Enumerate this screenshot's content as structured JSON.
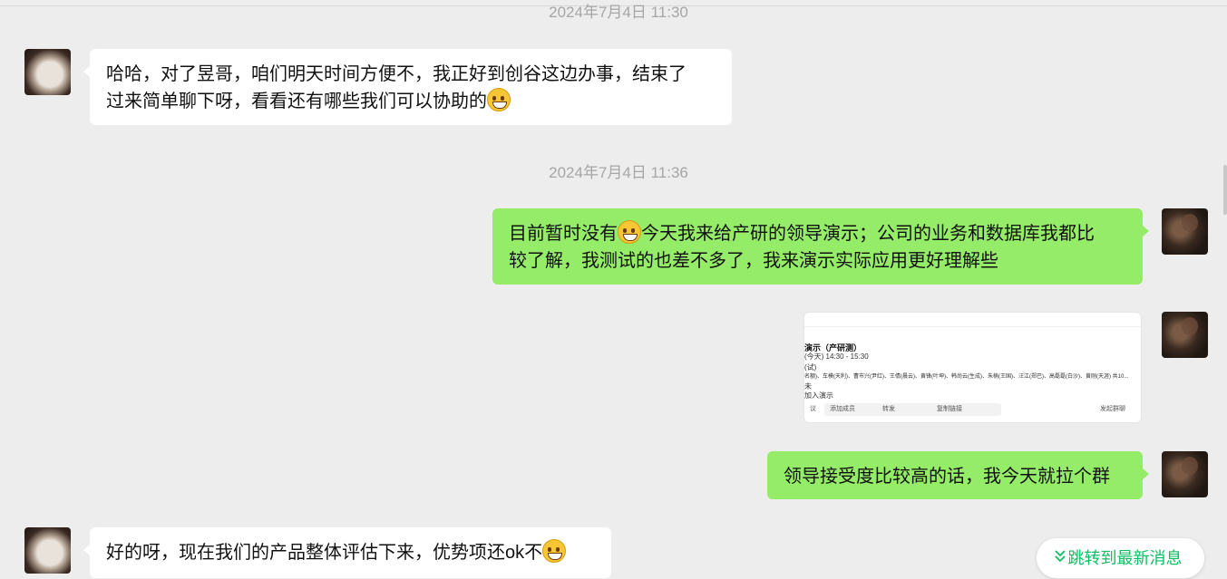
{
  "timestamps": [
    "2024年7月4日 11:30",
    "2024年7月4日 11:36"
  ],
  "messages": [
    {
      "side": "left",
      "text_line1": "哈哈，对了昱哥，咱们明天时间方便不，我正好到创谷这边办事，结束了",
      "text_line2": "过来简单聊下呀，看看还有哪些我们可以协助的",
      "emoji": "grin-emoji"
    },
    {
      "side": "right",
      "text_line1_a": "目前暂时没有",
      "emoji": "tears-of-joy-emoji",
      "text_line1_b": "今天我来给产研的领导演示；公司的业务和数据库我都比",
      "text_line2": "较了解，我测试的也差不多了，我来演示实际应用更好理解些"
    },
    {
      "side": "right",
      "type": "image"
    },
    {
      "side": "right",
      "text": "领导接受度比较高的话，我今天就拉个群"
    },
    {
      "side": "left",
      "text": "好的呀，现在我们的产品整体评估下来，优势项还ok不",
      "emoji": "flushed-emoji"
    }
  ],
  "screenshot_image": {
    "title": "演示（产研测）",
    "time": "(今天) 14:30 - 15:30",
    "line3": "(试)",
    "line4": "名额)、车模(天利)、曹市兴(尹红)、王倩(晨云)、黄锋(叶坤)、韩尚云(生成)、朱楠(王国)、汪江(郑巴)、高磊磊(白沙)、黄刚(天涯) 共10...",
    "line5": "未",
    "line6": "加入演示",
    "buttons": [
      "议",
      "添加成员",
      "转发",
      "复制链接",
      "发起群聊"
    ]
  },
  "jump_button": {
    "label": "跳转到最新消息",
    "icon": "double-chevron-down-icon"
  },
  "colors": {
    "background": "#ededed",
    "self_bubble": "#95ec69",
    "other_bubble": "#ffffff",
    "accent": "#07c160"
  }
}
